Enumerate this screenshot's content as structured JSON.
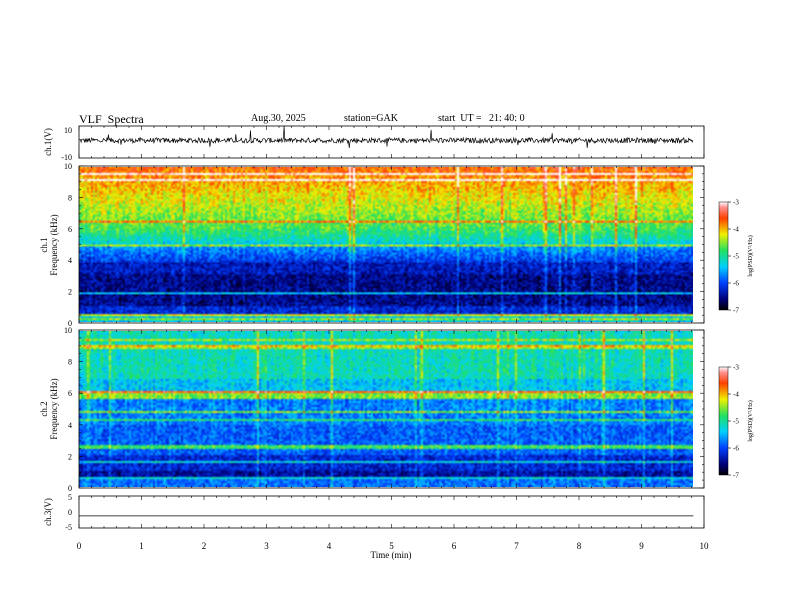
{
  "header": {
    "title": "VLF  Spectra",
    "date": "Aug.30, 2025",
    "station": "station=GAK",
    "start_ut": "start  UT =   21: 40: 0"
  },
  "chart_data": [
    {
      "type": "line",
      "name": "ch1-waveform",
      "ylabel": "ch.1(V)",
      "ylim": [
        -10,
        10
      ],
      "yticks": [
        "10",
        "-10"
      ],
      "xlim": [
        0,
        10
      ],
      "baseline": 0,
      "color": "#000000"
    },
    {
      "type": "heatmap",
      "name": "ch1-spectrogram",
      "ylabel": "ch.1\nFrequency (kHz)",
      "ylabel_line1": "ch.1",
      "ylabel_line2": "Frequency  (kHz)",
      "ylim": [
        0,
        10
      ],
      "yticks": [
        "0",
        "2",
        "4",
        "6",
        "8",
        "10"
      ],
      "xlim": [
        0,
        10
      ],
      "data_end_min": 9.83,
      "colorbar": {
        "label": "log(PSD)(V²/Hz)",
        "range": [
          -7,
          -3
        ],
        "ticks": [
          "-3",
          "-4",
          "-5",
          "-6",
          "-7"
        ]
      }
    },
    {
      "type": "heatmap",
      "name": "ch2-spectrogram",
      "ylabel_line1": "ch.2",
      "ylabel_line2": "Frequency  (kHz)",
      "ylim": [
        0,
        10
      ],
      "yticks": [
        "0",
        "2",
        "4",
        "6",
        "8",
        "10"
      ],
      "xlim": [
        0,
        10
      ],
      "data_end_min": 9.83,
      "colorbar": {
        "label": "log(PSD)(V²/Hz)",
        "range": [
          -7,
          -3
        ],
        "ticks": [
          "-3",
          "-4",
          "-5",
          "-6",
          "-7"
        ]
      }
    },
    {
      "type": "line",
      "name": "ch3-waveform",
      "ylabel": "ch.3(V)",
      "ylim": [
        -5,
        5
      ],
      "yticks": [
        "5",
        "0",
        "-5"
      ],
      "xlim": [
        0,
        10
      ],
      "constant_value": -1.2,
      "color": "#000000"
    }
  ],
  "xaxis": {
    "label": "Time  (min)",
    "ticks": [
      "0",
      "1",
      "2",
      "3",
      "4",
      "5",
      "6",
      "7",
      "8",
      "9",
      "10"
    ]
  },
  "colors": {
    "axis": "#000000",
    "background": "#ffffff"
  }
}
